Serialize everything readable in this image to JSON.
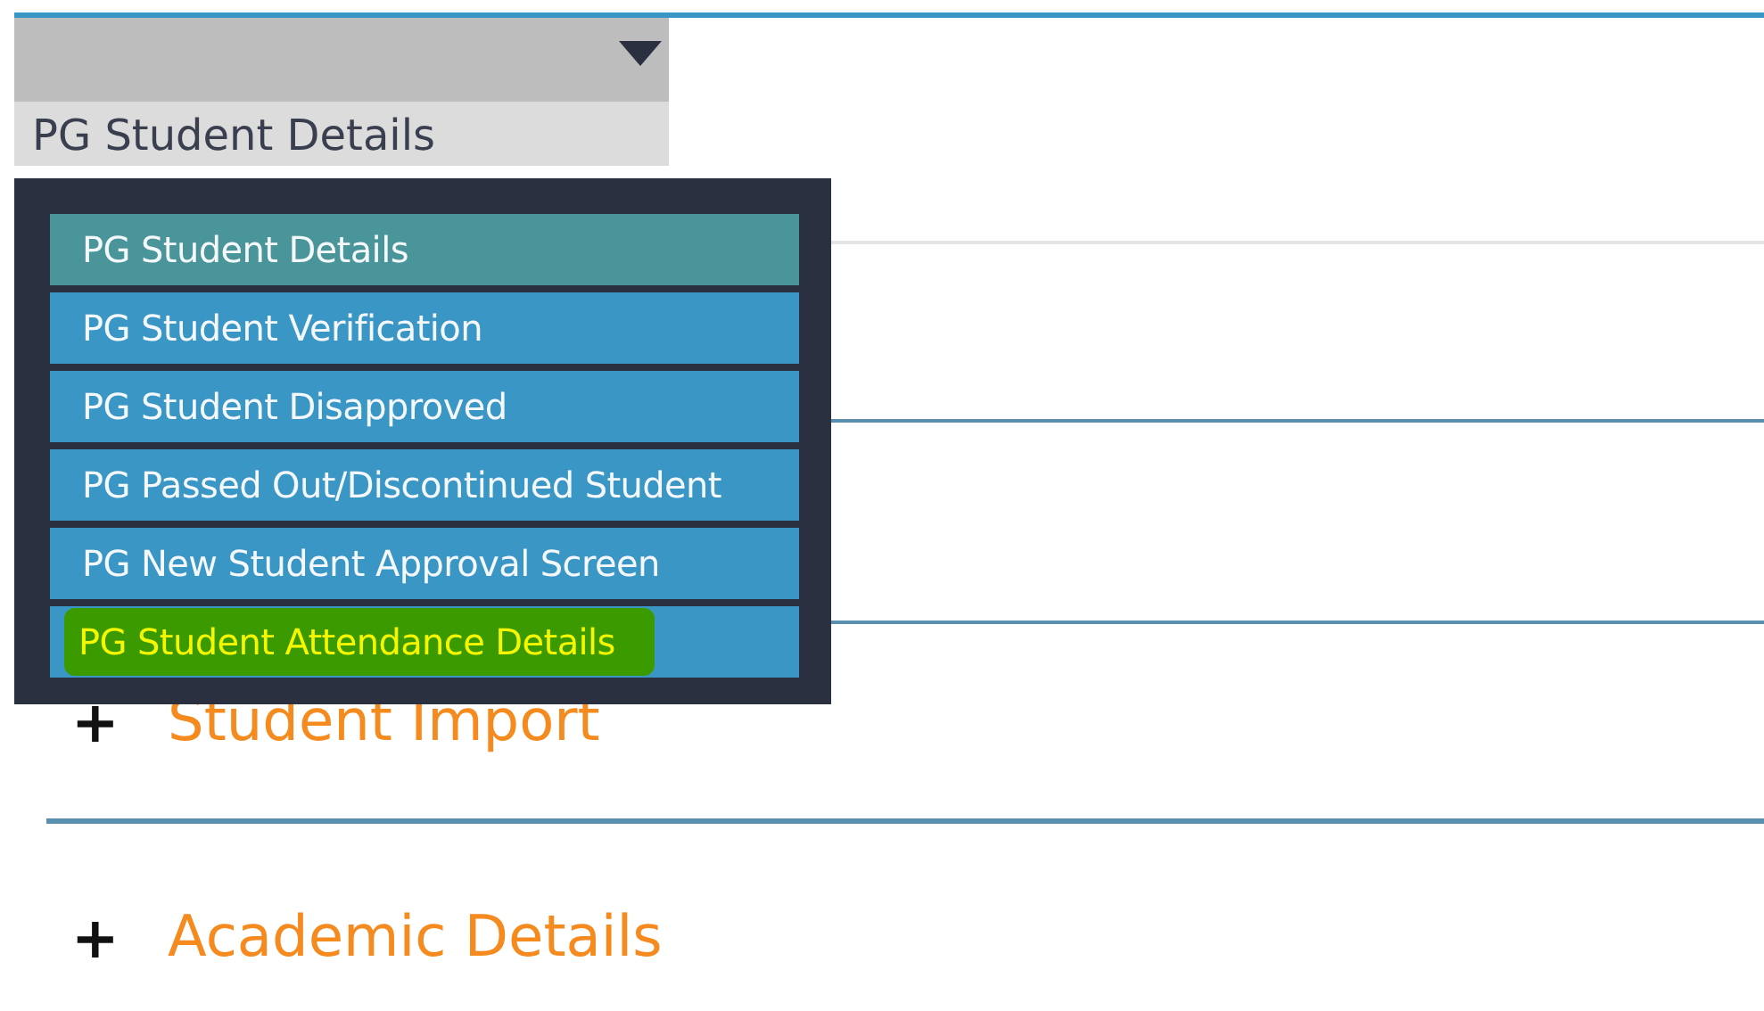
{
  "dropdown": {
    "label": "PG Student Details",
    "expanded": true
  },
  "menu": {
    "items": [
      {
        "label": "PG Student Details",
        "selected": true,
        "highlighted": false
      },
      {
        "label": "PG Student Verification",
        "selected": false,
        "highlighted": false
      },
      {
        "label": "PG Student Disapproved",
        "selected": false,
        "highlighted": false
      },
      {
        "label": "PG Passed Out/Discontinued Student",
        "selected": false,
        "highlighted": false
      },
      {
        "label": "PG New Student Approval Screen",
        "selected": false,
        "highlighted": false
      },
      {
        "label": "PG Student Attendance Details",
        "selected": false,
        "highlighted": true
      }
    ]
  },
  "sections": [
    {
      "toggle": "+",
      "title": "Student Import"
    },
    {
      "toggle": "+",
      "title": "Academic Details"
    }
  ]
}
